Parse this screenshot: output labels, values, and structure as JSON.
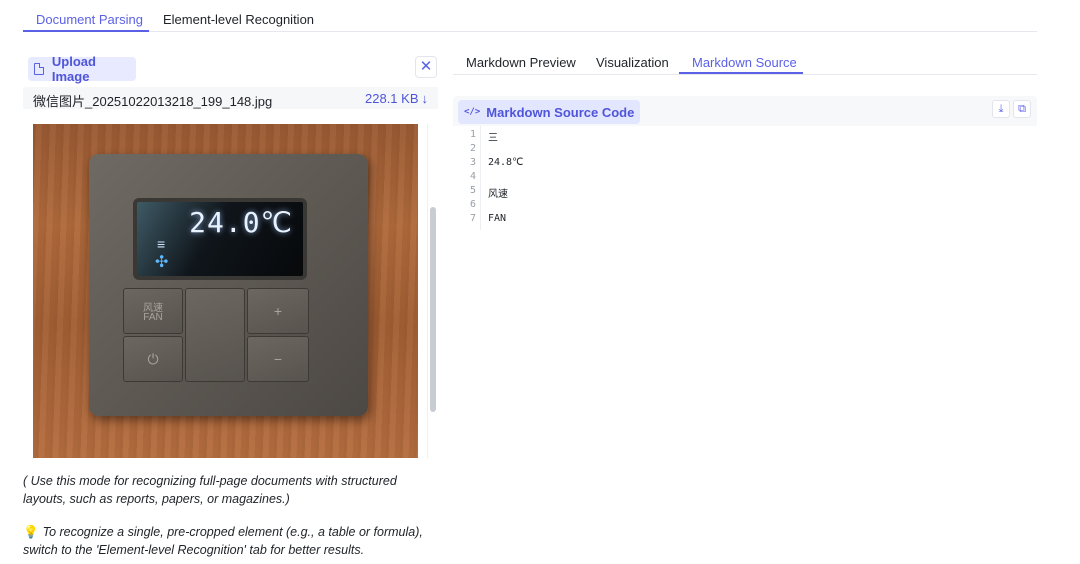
{
  "top_tabs": [
    {
      "label": "Document Parsing",
      "active": true
    },
    {
      "label": "Element-level Recognition",
      "active": false
    }
  ],
  "upload": {
    "button_label": "Upload Image",
    "close_symbol": "✕",
    "file_name": "微信图片_20251022013218_199_148.jpg",
    "file_size": "228.1 KB",
    "download_arrow": "↓"
  },
  "photo": {
    "display_temp": "24.0℃",
    "level_glyph": "≡",
    "fan_glyph": "✣",
    "key_fan_cn": "风速",
    "key_fan_en": "FAN",
    "key_power": "⏻",
    "key_plus": "+",
    "key_minus": "−"
  },
  "notes": {
    "mode_hint": "( Use this mode for recognizing full-page documents with structured layouts, such as reports, papers, or magazines.)",
    "bulb_icon": "💡",
    "element_hint": "To recognize a single, pre-cropped element (e.g., a table or formula), switch to the 'Element-level Recognition' tab for better results."
  },
  "result_tabs": [
    {
      "label": "Markdown Preview",
      "active": false
    },
    {
      "label": "Visualization",
      "active": false
    },
    {
      "label": "Markdown Source",
      "active": true
    }
  ],
  "code_panel": {
    "label": "Markdown Source Code",
    "tag_icon": "</>",
    "download_icon": "⤓",
    "copy_icon": "⧉",
    "lines": [
      {
        "num": "1",
        "text": "三"
      },
      {
        "num": "2",
        "text": ""
      },
      {
        "num": "3",
        "text": "24.8℃"
      },
      {
        "num": "4",
        "text": ""
      },
      {
        "num": "5",
        "text": "风速"
      },
      {
        "num": "6",
        "text": ""
      },
      {
        "num": "7",
        "text": "FAN"
      }
    ]
  },
  "colors": {
    "accent": "#5b61e6",
    "accent_bg": "#e8eaff"
  }
}
